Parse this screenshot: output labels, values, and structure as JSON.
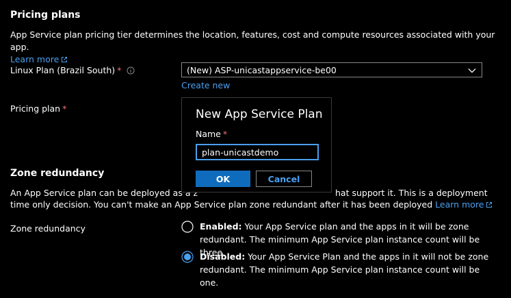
{
  "pricing": {
    "title": "Pricing plans",
    "description": "App Service plan pricing tier determines the location, features, cost and compute resources associated with your app.",
    "learn_more": "Learn more"
  },
  "linux_plan": {
    "label": "Linux Plan (Brazil South)",
    "required_mark": "*",
    "selected_value": "(New) ASP-unicastappservice-be00",
    "create_new": "Create new"
  },
  "pricing_plan": {
    "label": "Pricing plan",
    "required_mark": "*"
  },
  "popup": {
    "title": "New App Service Plan",
    "name_label": "Name",
    "required_mark": "*",
    "name_value": "plan-unicastdemo",
    "ok_label": "OK",
    "cancel_label": "Cancel"
  },
  "zone": {
    "title": "Zone redundancy",
    "desc_line1_left": "An App Service plan can be deployed as a z",
    "desc_line1_right": "hat support it. This is a deployment",
    "desc_line2": "time only decision. You can't make an App Service plan zone redundant after it has been deployed",
    "learn_more": "Learn more",
    "label": "Zone redundancy",
    "options": [
      {
        "title": "Enabled:",
        "text": "Your App Service plan and the apps in it will be zone redundant. The minimum App Service plan instance count will be three.",
        "selected": false
      },
      {
        "title": "Disabled:",
        "text": "Your App Service Plan and the apps in it will not be zone redundant. The minimum App Service plan instance count will be one.",
        "selected": true
      }
    ]
  },
  "colors": {
    "background": "#000000",
    "link": "#4aa0f0",
    "primary_button": "#0f6cbd",
    "required": "#f1707b",
    "border": "#8a8886"
  },
  "icons": {
    "external_link": "external-link-icon",
    "info": "info-icon",
    "dropdown": "chevron-down-icon"
  }
}
